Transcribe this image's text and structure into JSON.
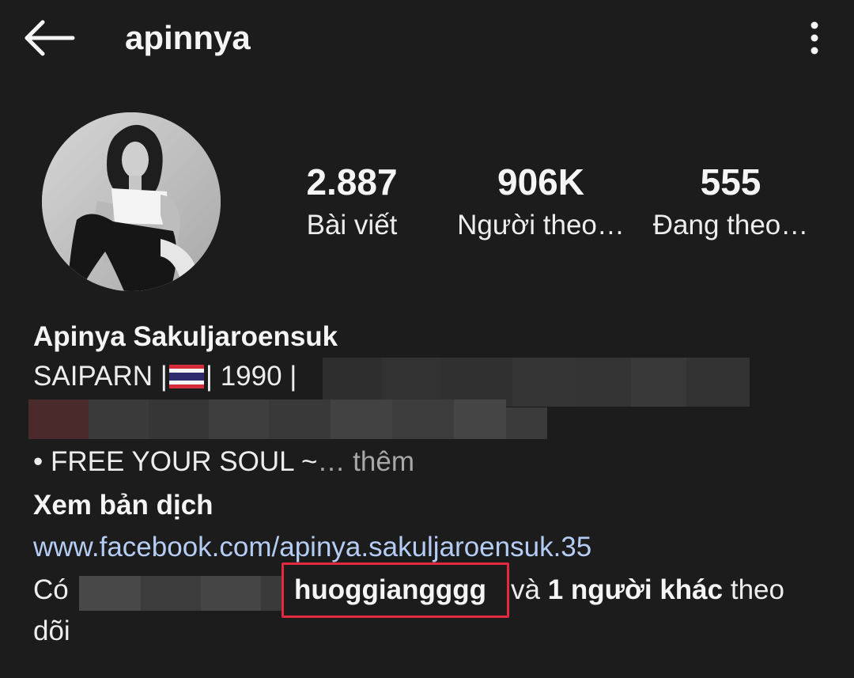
{
  "header": {
    "username": "apinnya"
  },
  "stats": {
    "posts_value": "2.887",
    "posts_label": "Bài viết",
    "followers_value": "906K",
    "followers_label": "Người theo…",
    "following_value": "555",
    "following_label": "Đang theo…"
  },
  "profile": {
    "full_name": "Apinya Sakuljaroensuk",
    "bio_line1_prefix": "SAIPARN |",
    "bio_line1_suffix": "| 1990 |",
    "bio_line3": "• FREE YOUR SOUL ~",
    "more_label": "… thêm",
    "translate_label": "Xem bản dịch",
    "website": "www.facebook.com/apinya.sakuljaroensuk.35"
  },
  "mutual": {
    "prefix": "Có",
    "highlighted_user": "huoggiangggg",
    "connector": "và",
    "others": "1 người khác",
    "suffix": "theo",
    "line2": "dõi"
  },
  "colors": {
    "background": "#1c1c1c",
    "text": "#f5f5f5",
    "link": "#b5cdf5",
    "highlight_box": "#e32a3f",
    "muted": "#a8a8a8"
  },
  "icons": [
    "back-arrow-icon",
    "more-vertical-icon",
    "thailand-flag-icon"
  ]
}
